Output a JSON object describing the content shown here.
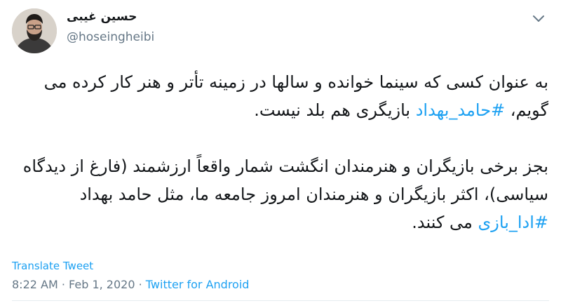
{
  "author": {
    "name": "حسین غیبی",
    "handle": "@hoseingheibi"
  },
  "tweet": {
    "p1_a": "به عنوان کسی که سینما خوانده و سالها در زمینه تأتر و هنر کار کرده می گویم، ",
    "p1_tag": "#حامد_بهداد",
    "p1_b": " بازیگری هم بلد نیست.",
    "p2_a": "بجز برخی بازیگران و هنرمندان انگشت شمار واقعاً ارزشمند (فارغ از دیدگاه سیاسی)، اکثر بازیگران و هنرمندان امروز جامعه ما، مثل حامد بهداد ",
    "p2_tag": "#ادا_بازی",
    "p2_b": " می کنند."
  },
  "translate_label": "Translate Tweet",
  "meta": {
    "time": "8:22 AM",
    "sep1": " · ",
    "date": "Feb 1, 2020",
    "sep2": " · ",
    "source": "Twitter for Android"
  },
  "icons": {
    "menu": "chevron-down-icon",
    "avatar": "avatar"
  },
  "colors": {
    "link": "#1da1f2",
    "secondary": "#657786",
    "text": "#14171a"
  }
}
